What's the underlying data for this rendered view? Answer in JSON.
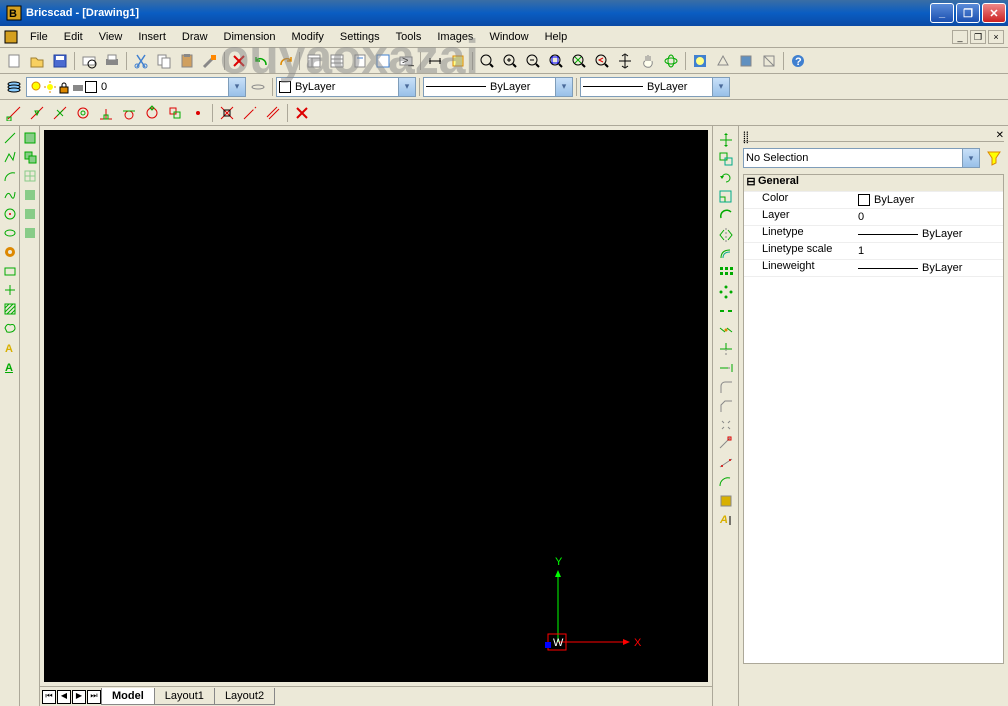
{
  "window": {
    "title": "Bricscad - [Drawing1]"
  },
  "menu": [
    "File",
    "Edit",
    "View",
    "Insert",
    "Draw",
    "Dimension",
    "Modify",
    "Settings",
    "Tools",
    "Images",
    "Window",
    "Help"
  ],
  "layer_toolbar": {
    "layer_value": "0",
    "color_value": "ByLayer",
    "linetype_value": "ByLayer",
    "lineweight_value": "ByLayer"
  },
  "tabs": {
    "items": [
      "Model",
      "Layout1",
      "Layout2"
    ],
    "active": 0
  },
  "properties": {
    "selection": "No Selection",
    "group": "General",
    "rows": [
      {
        "k": "Color",
        "v": "ByLayer",
        "swatch": true
      },
      {
        "k": "Layer",
        "v": "0"
      },
      {
        "k": "Linetype",
        "v": "ByLayer",
        "line": true
      },
      {
        "k": "Linetype scale",
        "v": "1"
      },
      {
        "k": "Lineweight",
        "v": "ByLayer",
        "line": true
      }
    ]
  },
  "ucs": {
    "label": "W",
    "x": "X",
    "y": "Y"
  },
  "watermark": "ouyaoxazai"
}
